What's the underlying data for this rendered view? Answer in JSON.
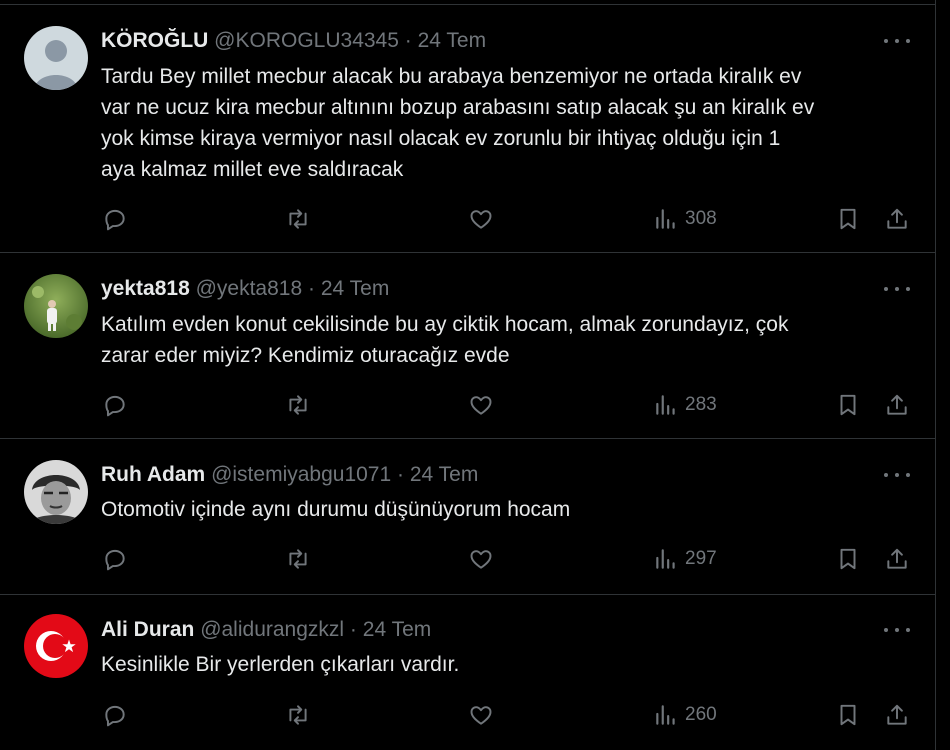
{
  "tweets": [
    {
      "name": "KÖROĞLU",
      "handle": "@KOROGLU34345",
      "separator": "·",
      "time": "24 Tem",
      "text": "Tardu Bey millet mecbur alacak bu arabaya benzemiyor ne ortada kiralık ev\nvar ne ucuz kira mecbur altınını bozup arabasını satıp alacak şu an kiralık ev\nyok kimse kiraya vermiyor nasıl olacak ev zorunlu  bir ihtiyaç olduğu için 1\naya kalmaz millet eve saldıracak",
      "views": "308",
      "avatar": "default-profile-icon"
    },
    {
      "name": "yekta818",
      "handle": "@yekta818",
      "separator": "·",
      "time": "24 Tem",
      "text": "Katılım evden konut cekilisinde bu ay ciktik hocam, almak zorundayız, çok\nzarar eder miyiz? Kendimiz oturacağız evde",
      "views": "283",
      "avatar": "child-in-grass-photo"
    },
    {
      "name": "Ruh Adam",
      "handle": "@istemiyabgu1071",
      "separator": "·",
      "time": "24 Tem",
      "text": "Otomotiv içinde aynı durumu düşünüyorum hocam",
      "views": "297",
      "avatar": "black-white-portrait-photo"
    },
    {
      "name": "Ali Duran",
      "handle": "@alidurangzkzl",
      "separator": "·",
      "time": "24 Tem",
      "text": "Kesinlikle Bir yerlerden çıkarları vardır.",
      "views": "260",
      "avatar": "turkish-flag-icon"
    }
  ],
  "icons": {
    "reply": "reply-icon",
    "retweet": "retweet-icon",
    "like": "like-icon",
    "views": "views-icon",
    "bookmark": "bookmark-icon",
    "share": "share-icon",
    "more": "more-icon"
  },
  "colors": {
    "background": "#000000",
    "text": "#e7e9ea",
    "secondary": "#71767b",
    "divider": "#2f3336",
    "flag_red": "#e30a17"
  }
}
